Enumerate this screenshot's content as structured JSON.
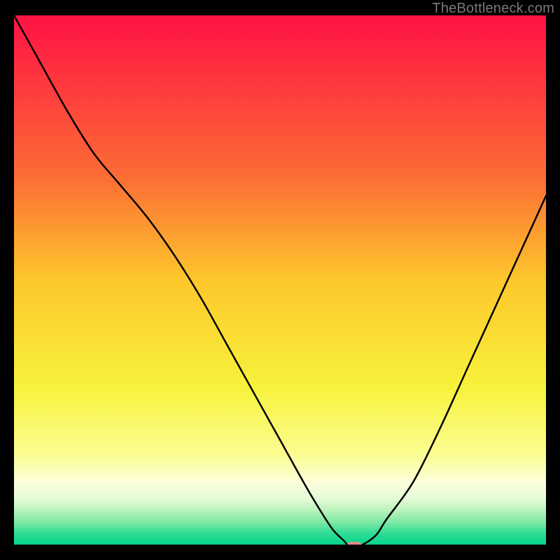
{
  "attribution": {
    "text": "TheBottleneck.com"
  },
  "chart_data": {
    "type": "line",
    "title": "",
    "xlabel": "",
    "ylabel": "",
    "xlim": [
      0,
      100
    ],
    "ylim": [
      0,
      100
    ],
    "grid": false,
    "x": [
      0,
      5,
      10,
      15,
      20,
      25,
      30,
      35,
      40,
      45,
      50,
      55,
      58,
      60,
      62,
      63,
      65,
      68,
      70,
      75,
      80,
      85,
      90,
      95,
      100
    ],
    "y": [
      100,
      91,
      82,
      74,
      68,
      62,
      55,
      47,
      38,
      29,
      20,
      11,
      6,
      3,
      1,
      0,
      0,
      2,
      5,
      12,
      22,
      33,
      44,
      55,
      66
    ],
    "minimum_marker": {
      "x_percent": 64,
      "y_percent": 0,
      "color": "#EB8A8A"
    },
    "gradient_stops": [
      {
        "pct": 0.0,
        "color": "#FF1244"
      },
      {
        "pct": 0.3,
        "color": "#FC6B35"
      },
      {
        "pct": 0.5,
        "color": "#FDC72C"
      },
      {
        "pct": 0.7,
        "color": "#F7F23B"
      },
      {
        "pct": 0.83,
        "color": "#FBFD93"
      },
      {
        "pct": 0.88,
        "color": "#FDFEDB"
      },
      {
        "pct": 0.91,
        "color": "#E6FBD9"
      },
      {
        "pct": 0.93,
        "color": "#C1F4BF"
      },
      {
        "pct": 0.955,
        "color": "#7EE9A4"
      },
      {
        "pct": 0.975,
        "color": "#33DD96"
      },
      {
        "pct": 1.0,
        "color": "#00D38B"
      }
    ]
  }
}
